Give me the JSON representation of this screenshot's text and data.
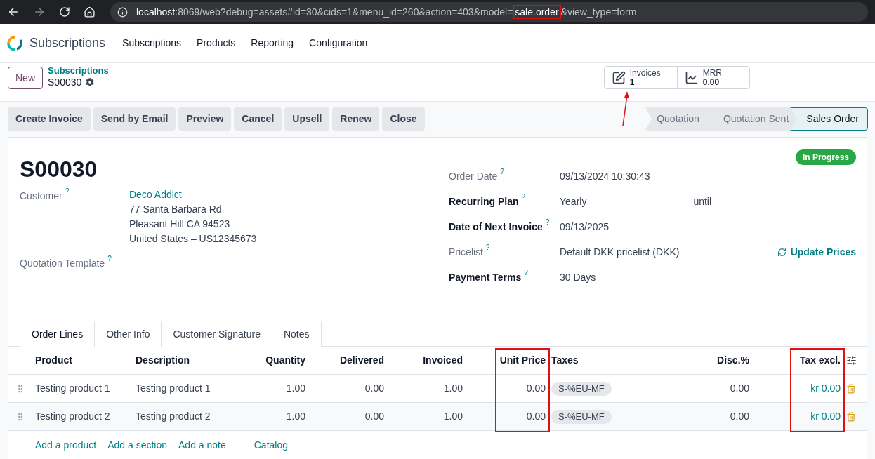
{
  "browser": {
    "url_host": "localhost",
    "url_path": ":8069/web?debug=assets#id=30&cids=1&menu_id=260&action=403&model=",
    "url_highlight": "sale.order",
    "url_tail": "&view_type=form"
  },
  "app": {
    "name": "Subscriptions",
    "menu": [
      "Subscriptions",
      "Products",
      "Reporting",
      "Configuration"
    ]
  },
  "control_panel": {
    "new_button": "New",
    "breadcrumb": "Subscriptions",
    "record": "S00030"
  },
  "smart_buttons": [
    {
      "kind": "invoices",
      "label": "Invoices",
      "value": "1",
      "arrow": true
    },
    {
      "kind": "mrr",
      "label": "MRR",
      "value": "0.00",
      "arrow": false
    }
  ],
  "actions": [
    "Create Invoice",
    "Send by Email",
    "Preview",
    "Cancel",
    "Upsell",
    "Renew",
    "Close"
  ],
  "stages": [
    {
      "label": "Quotation",
      "selected": false
    },
    {
      "label": "Quotation Sent",
      "selected": false
    },
    {
      "label": "Sales Order",
      "selected": true
    }
  ],
  "sheet": {
    "title": "S00030",
    "status": "In Progress",
    "fields_left": [
      {
        "label": "Customer",
        "help": "?",
        "required": false,
        "link": "Deco Addict",
        "lines": [
          "77 Santa Barbara Rd",
          "Pleasant Hill CA 94523",
          "United States – US12345673"
        ]
      },
      {
        "label": "Quotation Template",
        "help": "?",
        "required": false
      }
    ],
    "fields_right": [
      {
        "label": "Order Date",
        "help": "?",
        "required": false,
        "value": "09/13/2024 10:30:43"
      },
      {
        "label": "Recurring Plan",
        "help": "?",
        "required": true,
        "value": "Yearly",
        "suffix": "until"
      },
      {
        "label": "Date of Next Invoice",
        "help": "?",
        "required": true,
        "value": "09/13/2025"
      },
      {
        "label": "Pricelist",
        "help": "?",
        "required": false,
        "value": "Default DKK pricelist (DKK)",
        "action": "Update Prices"
      },
      {
        "label": "Payment Terms",
        "help": "?",
        "required": true,
        "value": "30 Days"
      }
    ]
  },
  "tabs": [
    {
      "label": "Order Lines",
      "selected": true
    },
    {
      "label": "Other Info",
      "selected": false
    },
    {
      "label": "Customer Signature",
      "selected": false
    },
    {
      "label": "Notes",
      "selected": false
    }
  ],
  "table": {
    "columns": [
      {
        "label": "Product",
        "kind": "text",
        "highlighted": false
      },
      {
        "label": "Description",
        "kind": "text",
        "highlighted": false
      },
      {
        "label": "Quantity",
        "kind": "number",
        "highlighted": false
      },
      {
        "label": "Delivered",
        "kind": "number",
        "highlighted": false
      },
      {
        "label": "Invoiced",
        "kind": "number",
        "highlighted": false
      },
      {
        "label": "Unit Price",
        "kind": "number",
        "highlighted": true
      },
      {
        "label": "Taxes",
        "kind": "tag",
        "highlighted": false
      },
      {
        "label": "Disc.%",
        "kind": "number",
        "highlighted": false
      },
      {
        "label": "Tax excl.",
        "kind": "amount",
        "highlighted": true
      }
    ],
    "rows": [
      {
        "cells": [
          "Testing product 1",
          "Testing product 1",
          "1.00",
          "0.00",
          "1.00",
          "0.00",
          "S-%EU-MF",
          "0.00",
          "kr 0.00"
        ]
      },
      {
        "cells": [
          "Testing product 2",
          "Testing product 2",
          "1.00",
          "0.00",
          "1.00",
          "0.00",
          "S-%EU-MF",
          "0.00",
          "kr 0.00"
        ]
      }
    ],
    "add_links": [
      "Add a product",
      "Add a section",
      "Add a note",
      "Catalog"
    ]
  }
}
